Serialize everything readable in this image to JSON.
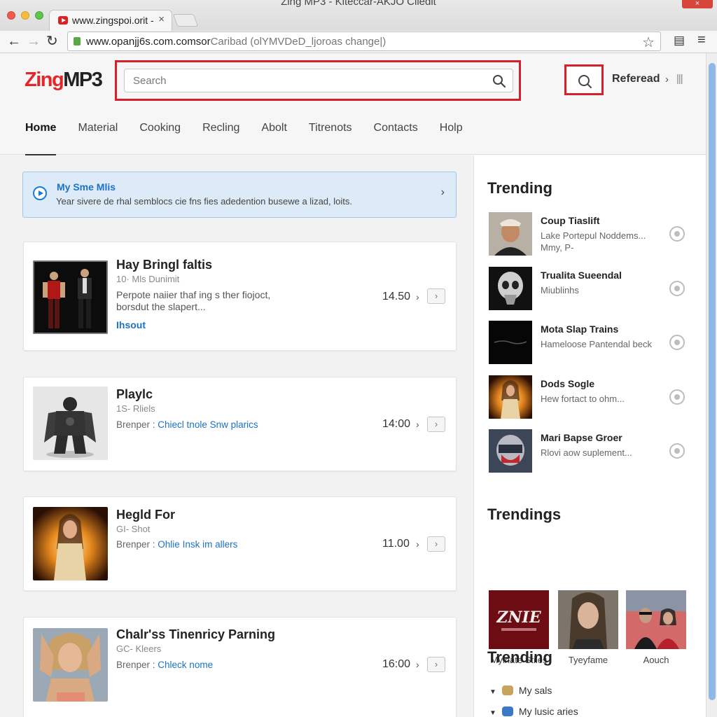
{
  "browser": {
    "window_title": "Zing MP3 - Kiteccar-AKJO Cliedit",
    "tab_title": "www.zingspoi.orit -",
    "tab_close": "×",
    "url_main": "www.opanjj6s.com.comsor",
    "url_rest": "Caribad (olYMVDeD_ljoroas change|)",
    "close_label": "×"
  },
  "header": {
    "logo_zing": "Zing",
    "logo_mp3": "MP3",
    "search_placeholder": "Search",
    "refresh_label": "Referead",
    "refresh_chevron": "›",
    "refresh_bars": "|||"
  },
  "nav": {
    "items": [
      "Home",
      "Material",
      "Cooking",
      "Recling",
      "Abolt",
      "Titrenots",
      "Contacts",
      "Holp"
    ]
  },
  "notice": {
    "title": "My Sme Mlis",
    "text": "Year sivere de rhal semblocs cie fns fies adedention busewe a lizad, loits.",
    "chevron": "›"
  },
  "cards": [
    {
      "title": "Hay Bringl faltis",
      "sub": "10· Mls Dunimit",
      "desc": "Perpote naiier thaf ing s ther fiojoct, borsdut the slapert...",
      "link": "Ihsout",
      "time": "14.50",
      "chev": "›",
      "btn": "›"
    },
    {
      "title": "Playlc",
      "sub": "1S- Rliels",
      "meta_label": "Brenper :",
      "meta_link": "Chiecl tnole Snw plarics",
      "time": "14:00",
      "chev": "›",
      "btn": "›"
    },
    {
      "title": "Hegld For",
      "sub": "GI- Shot",
      "meta_label": "Brenper :",
      "meta_link": "Ohlie Insk im allers",
      "time": "11.00",
      "chev": "›",
      "btn": "›"
    },
    {
      "title": "Chalr'ss Tinenricy Parning",
      "sub": "GC- Kleers",
      "meta_label": "Brenper :",
      "meta_link": "Chleck nome",
      "time": "16:00",
      "chev": "›",
      "btn": "›"
    }
  ],
  "sidebar": {
    "trending_title": "Trending",
    "trending_items": [
      {
        "title": "Coup Tiaslift",
        "sub": "Lake Portepul Noddems... Mmy, P-"
      },
      {
        "title": "Trualita Sueendal",
        "sub": "Miublinhs"
      },
      {
        "title": "Mota Slap Trains",
        "sub": "Hameloose Pantendal beck"
      },
      {
        "title": "Dods Sogle",
        "sub": "Hew fortact to ohm..."
      },
      {
        "title": "Mari Bapse Groer",
        "sub": "Rlovi aow suplement..."
      }
    ],
    "trendings_title": "Trendings",
    "grid": [
      {
        "label": "Myinate Stiles",
        "art_text": "ZNIE"
      },
      {
        "label": "Tyeyfame"
      },
      {
        "label": "Aouch"
      }
    ],
    "trending2_title": "Trending",
    "list": [
      {
        "label": "My sals",
        "caret": "▼"
      },
      {
        "label": "My lusic aries",
        "caret": "▼"
      }
    ]
  },
  "colors": {
    "accent_red": "#d6202a",
    "link_blue": "#1d72c2",
    "scroll_blue": "#8eb8e6"
  }
}
